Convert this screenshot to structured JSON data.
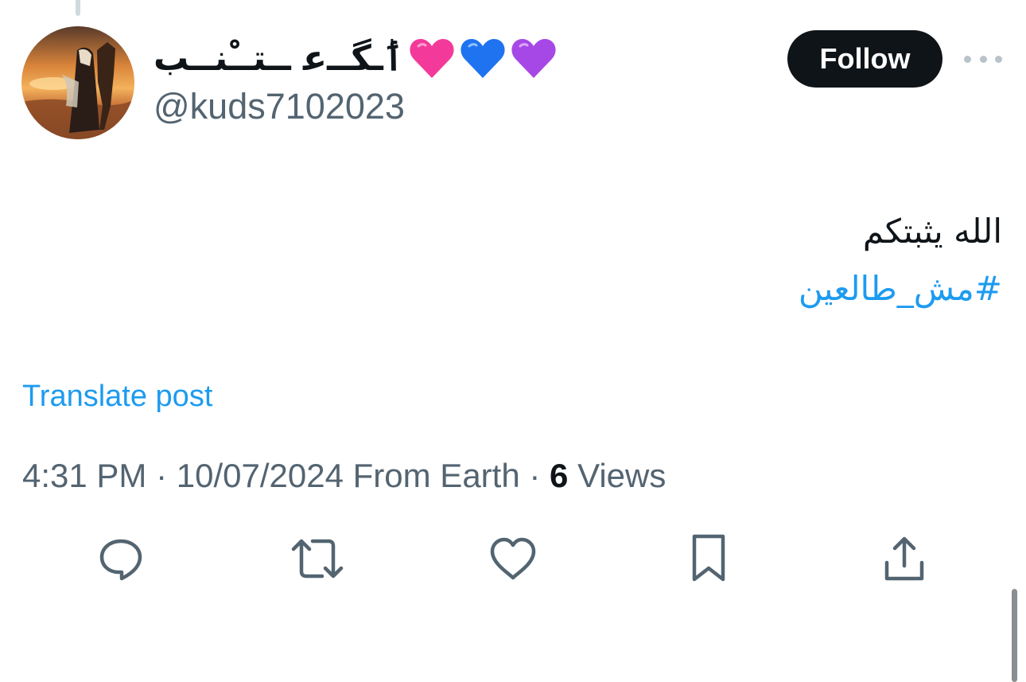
{
  "author": {
    "display_name": "ٲ‌ٰـگــ‌ﻋ ــتــْنــب",
    "display_name_emojis": [
      "pink-heart-icon",
      "blue-heart-icon",
      "purple-heart-icon"
    ],
    "handle": "@kuds7102023",
    "avatar": "avatar-horse-rider-sunset-image"
  },
  "header": {
    "follow_label": "Follow",
    "more_icon": "more-dots-icon"
  },
  "post": {
    "text": "الله يثبتكم",
    "hashtag": "#مش_طالعين",
    "translate_label": "Translate post"
  },
  "meta": {
    "time": "4:31 PM",
    "date": "10/07/2024",
    "source": "From Earth",
    "views_count": "6",
    "views_label": "Views",
    "separator": "·"
  },
  "actions": [
    {
      "name": "reply",
      "icon": "reply-icon"
    },
    {
      "name": "repost",
      "icon": "repost-icon"
    },
    {
      "name": "like",
      "icon": "heart-icon"
    },
    {
      "name": "bookmark",
      "icon": "bookmark-icon"
    },
    {
      "name": "share",
      "icon": "share-icon"
    }
  ],
  "colors": {
    "accent": "#1d9bf0",
    "text_primary": "#0f1419",
    "text_secondary": "#536471",
    "icon": "#536471",
    "follow_bg": "#0f1419"
  }
}
